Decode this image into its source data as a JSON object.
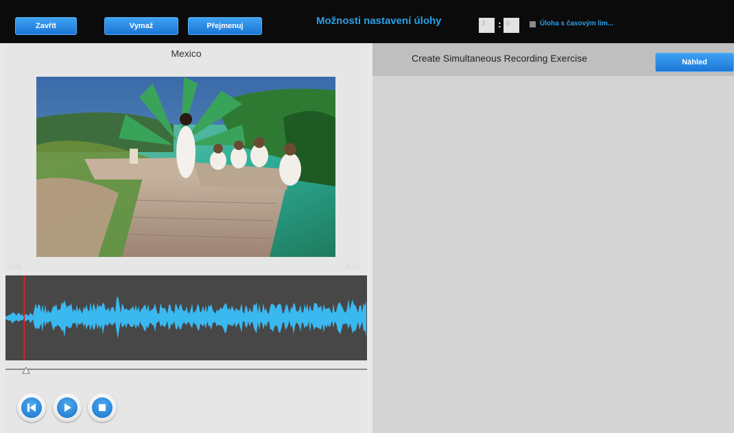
{
  "toolbar": {
    "close_label": "Zavřít",
    "clear_label": "Vymaž",
    "rename_label": "Přejmenuj",
    "title": "Možnosti nastavení úlohy",
    "minutes": "3",
    "seconds": "0",
    "timelimit_label": "Úloha s časovým lim..."
  },
  "left": {
    "title": "Mexico",
    "time_start": "0:00",
    "time_end": "0:10",
    "playhead_fraction": 0.05,
    "slider_fraction": 0.05
  },
  "controls": {
    "icons": [
      "skip-to-start-icon",
      "play-icon",
      "stop-icon"
    ]
  },
  "right": {
    "title": "Create Simultaneous Recording Exercise",
    "preview_label": "Náhled"
  },
  "colors": {
    "accent": "#2aa0e8",
    "waveform": "#3ab8f0",
    "playhead": "#e02020"
  }
}
